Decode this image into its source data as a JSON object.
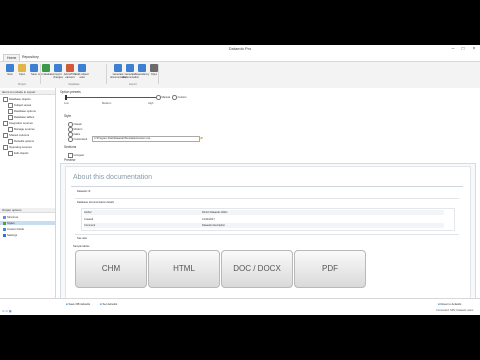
{
  "window": {
    "title": "Dataedo Pro"
  },
  "tabs": [
    "Home",
    "Repository"
  ],
  "ribbon": {
    "buttons": [
      {
        "label": "New",
        "icon": "new-file-icon",
        "color": "#3d7fd1"
      },
      {
        "label": "Open",
        "icon": "open-folder-icon",
        "color": "#e1b548"
      },
      {
        "label": "Save",
        "icon": "save-icon",
        "color": "#3d7fd1"
      },
      {
        "label": "Add database",
        "icon": "add-database-icon",
        "color": "#3a9a4a"
      },
      {
        "label": "Import changes",
        "icon": "import-icon",
        "color": "#3d7fd1"
      },
      {
        "label": "Add HTML element",
        "icon": "add-element-icon",
        "color": "#d25a3a"
      },
      {
        "label": "Add subject area",
        "icon": "subject-area-icon",
        "color": "#3d7fd1"
      },
      {
        "label": "Generate documentation",
        "icon": "generate-doc-icon",
        "color": "#3d7fd1"
      },
      {
        "label": "Generate documentation",
        "icon": "generate-doc-icon",
        "color": "#3d7fd1"
      },
      {
        "label": "Dependency",
        "icon": "dependency-icon",
        "color": "#3d7fd1"
      },
      {
        "label": "Open",
        "icon": "open-icon",
        "color": "#6a6a6a"
      }
    ],
    "groups": [
      "Project",
      "Database",
      "Export"
    ]
  },
  "sidebar": {
    "header1": "Items to include in export",
    "items": [
      {
        "label": "Database objects",
        "level": 0,
        "checked": true
      },
      {
        "label": "Subject areas",
        "level": 1,
        "checked": true
      },
      {
        "label": "Database options",
        "level": 1,
        "checked": true
      },
      {
        "label": "Database tables",
        "level": 1,
        "checked": true
      },
      {
        "label": "Integration sources",
        "level": 0,
        "checked": true
      },
      {
        "label": "Manage sources",
        "level": 1,
        "checked": true
      },
      {
        "label": "Shared columns",
        "level": 0,
        "checked": true
      },
      {
        "label": "Defaults options",
        "level": 1,
        "checked": true
      },
      {
        "label": "Operating sources",
        "level": 0,
        "checked": true
      },
      {
        "label": "Edit objects",
        "level": 1,
        "checked": true
      }
    ],
    "header2": "Output options",
    "options": [
      {
        "label": "Structure",
        "selected": false,
        "color": "#6a8bd0"
      },
      {
        "label": "Styles",
        "selected": true,
        "color": "#5d9a3a"
      },
      {
        "label": "Custom fields",
        "selected": false,
        "color": "#3a8ad0"
      },
      {
        "label": "Settings",
        "selected": false,
        "color": "#3a6ad0"
      }
    ]
  },
  "main": {
    "section1": "Option presets",
    "slider_left": "Low",
    "slider_mid": "Medium",
    "slider_right": "High",
    "radio1": "Manual",
    "radio2": "Custom",
    "section2": "Style",
    "style_opts": [
      "Classic",
      "Modern",
      "Italics",
      "Customized"
    ],
    "style_input": "C:\\Program Files\\Dataedo\\Templates\\custom.css",
    "section3": "Sections",
    "sections_check": "Compact",
    "preview_label": "Preview",
    "preview": {
      "title": "About this documentation",
      "row1": "Dataedo v6",
      "row2": "Database documentation details",
      "details": [
        {
          "k": "Author",
          "v": "Dimitri Dataedo Gibbs"
        },
        {
          "k": "Created",
          "v": "12/11/2017"
        },
        {
          "k": "Comment",
          "v": "Dataedo description"
        }
      ],
      "row3": "See also",
      "row4": "Sample tables",
      "buttons": [
        "CHM",
        "HTML",
        "DOC / DOCX",
        "PDF"
      ]
    }
  },
  "status": {
    "left1": "Save DB defaults",
    "left2": "Set defaults",
    "right1": "Reset to defaults",
    "right2": "Connected: SRV, Dataedo users"
  }
}
